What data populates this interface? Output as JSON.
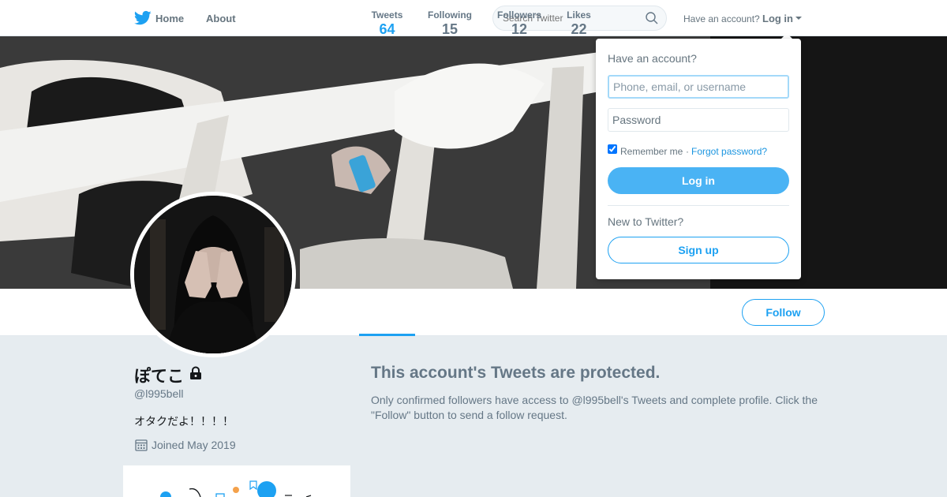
{
  "colors": {
    "brand": "#1da1f2",
    "background": "#e6ecf0",
    "text_muted": "#657786"
  },
  "nav": {
    "home_label": "Home",
    "about_label": "About",
    "search_placeholder": "Search Twitter",
    "have_account": "Have an account?",
    "login_label": "Log in"
  },
  "profile": {
    "name": "ぽてこ",
    "handle": "@l995bell",
    "bio": "オタクだよ！！！！",
    "joined": "Joined May 2019",
    "follow_label": "Follow",
    "stats": [
      {
        "label": "Tweets",
        "value": "64",
        "active": true
      },
      {
        "label": "Following",
        "value": "15",
        "active": false
      },
      {
        "label": "Followers",
        "value": "12",
        "active": false
      },
      {
        "label": "Likes",
        "value": "22",
        "active": false
      }
    ]
  },
  "protected": {
    "title": "This account's Tweets are protected.",
    "text": "Only confirmed followers have access to @l995bell's Tweets and complete profile. Click the \"Follow\" button to send a follow request."
  },
  "login_dropdown": {
    "title": "Have an account?",
    "username_placeholder": "Phone, email, or username",
    "password_placeholder": "Password",
    "remember_label": "Remember me",
    "separator": "·",
    "forgot_label": "Forgot password?",
    "login_button": "Log in",
    "new_label": "New to Twitter?",
    "signup_button": "Sign up"
  },
  "icons": [
    "twitter-bird-icon",
    "search-icon",
    "caret-down-icon",
    "lock-icon",
    "calendar-icon"
  ]
}
